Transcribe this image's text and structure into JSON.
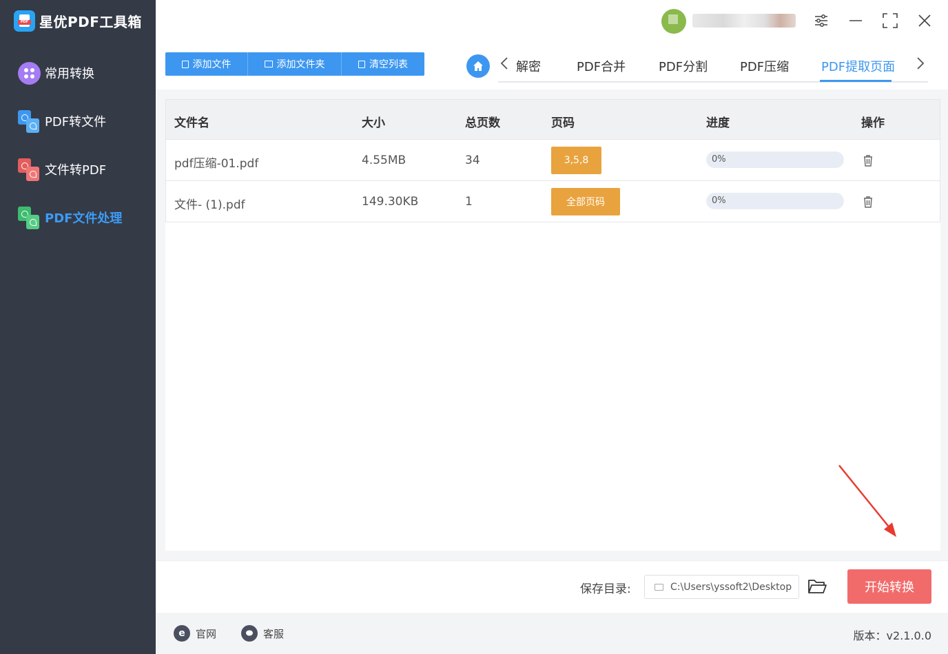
{
  "app": {
    "title": "星优PDF工具箱",
    "logo_tag": "PDF"
  },
  "sidebar": {
    "items": [
      {
        "label": "常用转换",
        "icon": "grid-circle-icon",
        "active": false
      },
      {
        "label": "PDF转文件",
        "icon": "pdf-to-file-icon",
        "active": false
      },
      {
        "label": "文件转PDF",
        "icon": "file-to-pdf-icon",
        "active": false
      },
      {
        "label": "PDF文件处理",
        "icon": "pdf-process-icon",
        "active": true
      }
    ]
  },
  "toolbar": {
    "add_file": "添加文件",
    "add_folder": "添加文件夹",
    "clear_list": "清空列表"
  },
  "tabs": {
    "items": [
      "解密",
      "PDF合并",
      "PDF分割",
      "PDF压缩",
      "PDF提取页面"
    ],
    "active": "PDF提取页面"
  },
  "table": {
    "headers": {
      "name": "文件名",
      "size": "大小",
      "pages": "总页数",
      "page_range": "页码",
      "progress": "进度",
      "action": "操作"
    },
    "rows": [
      {
        "name": "pdf压缩-01.pdf",
        "size": "4.55MB",
        "pages": "34",
        "page_range": "3,5,8",
        "progress_text": "0%",
        "progress": 0
      },
      {
        "name": "文件- (1).pdf",
        "size": "149.30KB",
        "pages": "1",
        "page_range": "全部页码",
        "progress_text": "0%",
        "progress": 0
      }
    ]
  },
  "bottom": {
    "save_label": "保存目录:",
    "save_path": "C:\\Users\\yssoft2\\Desktop",
    "start_label": "开始转换"
  },
  "footer": {
    "website": "官网",
    "support": "客服",
    "version": "版本：v2.1.0.0"
  },
  "colors": {
    "sidebar_bg": "#343a46",
    "accent": "#3d97f0",
    "page_button": "#e9a33e",
    "start_button": "#f26b6b",
    "annotation_arrow": "#e83a2f"
  }
}
